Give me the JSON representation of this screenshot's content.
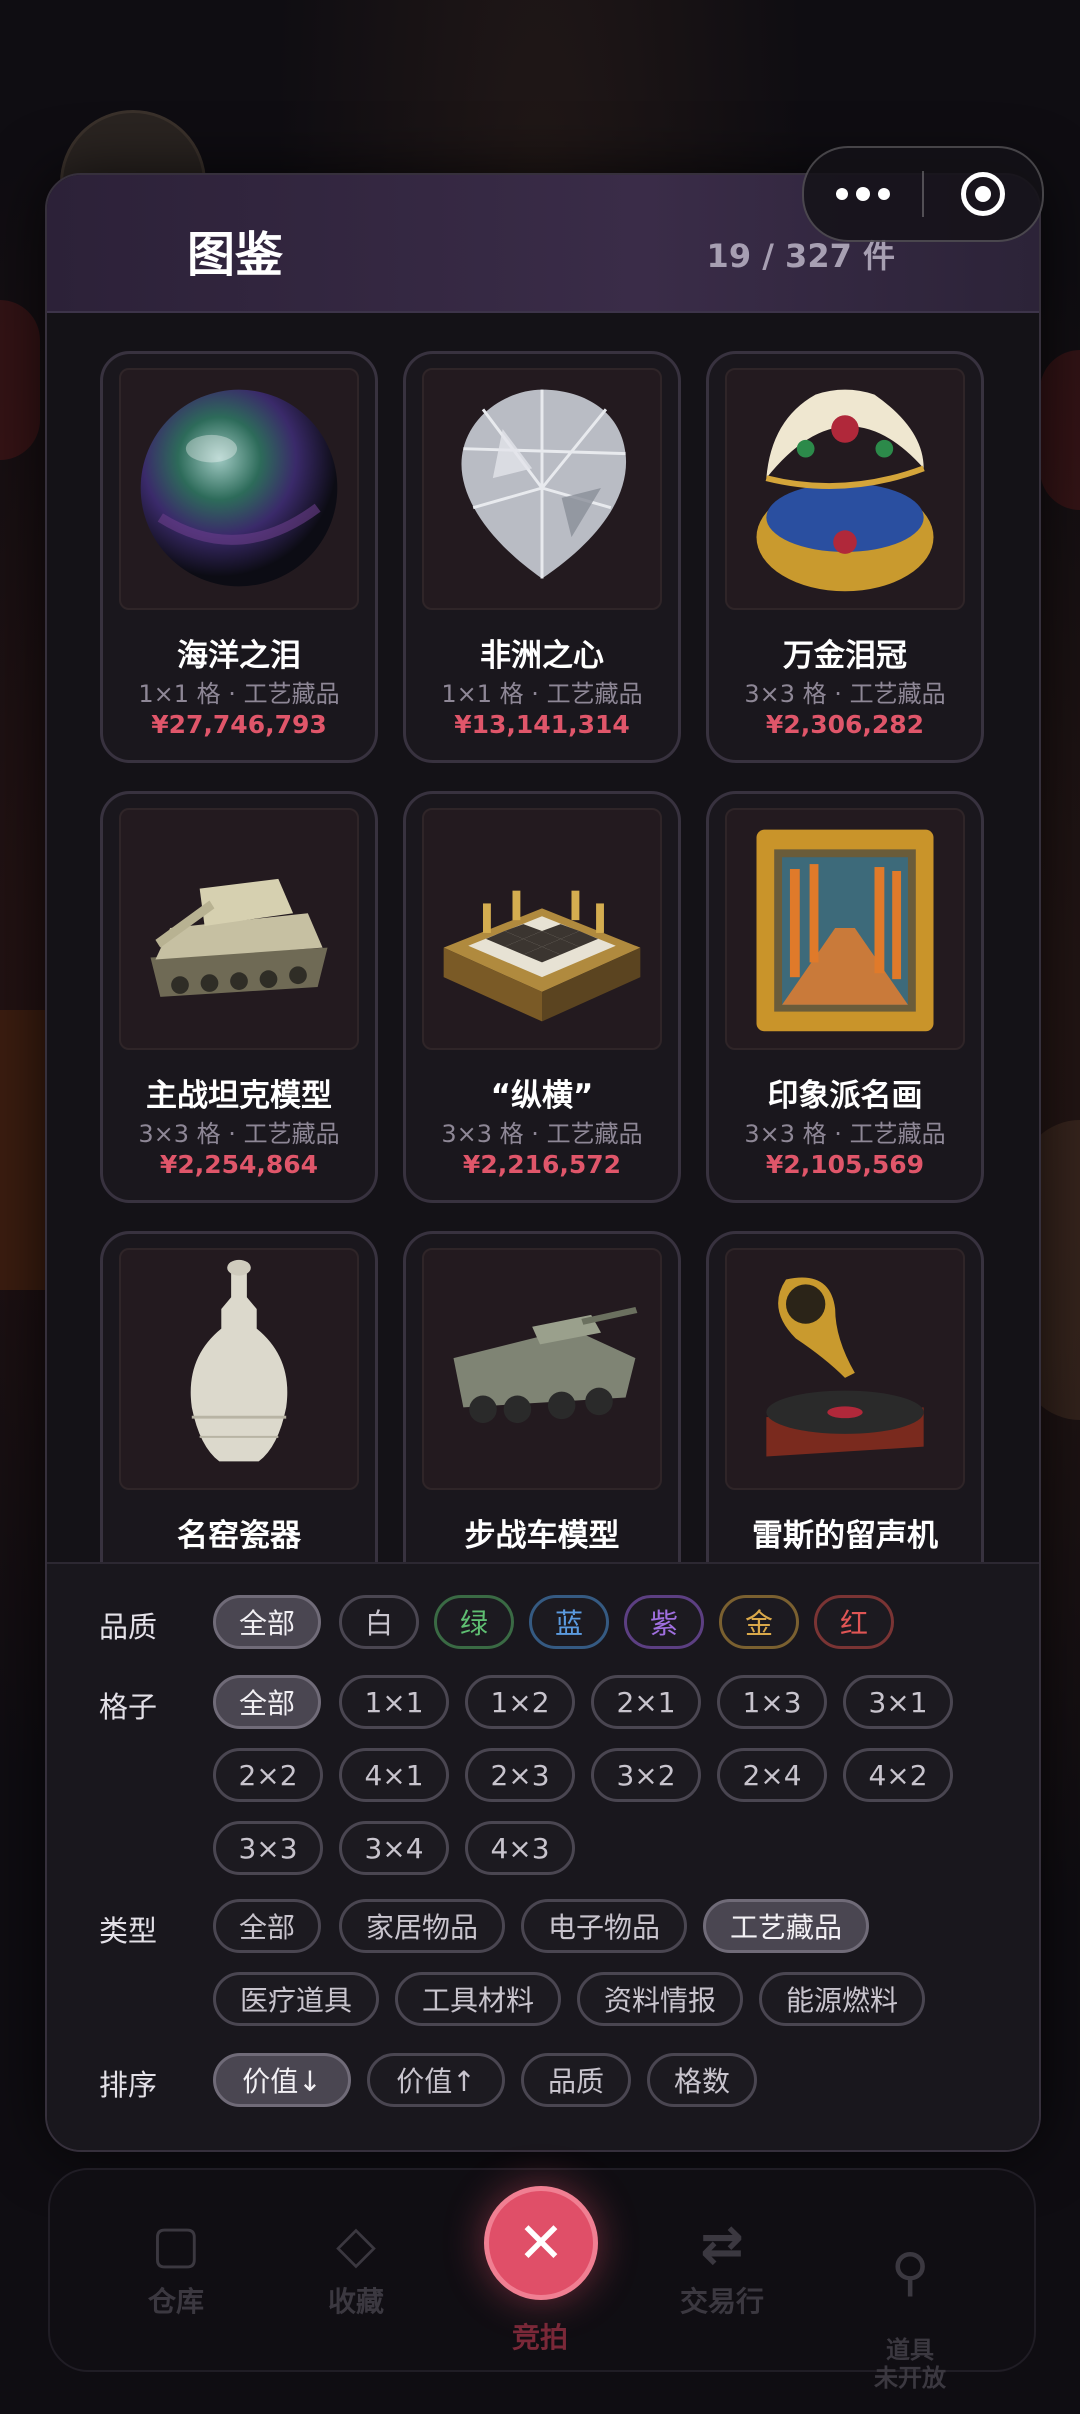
{
  "header": {
    "title": "图鉴",
    "count": "19 / 327 件"
  },
  "items": [
    {
      "name": "海洋之泪",
      "meta": "1×1 格 · 工艺藏品",
      "price": "¥27,746,793",
      "icon": "pearl-icon"
    },
    {
      "name": "非洲之心",
      "meta": "1×1 格 · 工艺藏品",
      "price": "¥13,141,314",
      "icon": "diamond-icon"
    },
    {
      "name": "万金泪冠",
      "meta": "3×3 格 · 工艺藏品",
      "price": "¥2,306,282",
      "icon": "jeweled-egg-icon"
    },
    {
      "name": "主战坦克模型",
      "meta": "3×3 格 · 工艺藏品",
      "price": "¥2,254,864",
      "icon": "tank-icon"
    },
    {
      "name": "“纵横”",
      "meta": "3×3 格 · 工艺藏品",
      "price": "¥2,216,572",
      "icon": "chessboard-icon"
    },
    {
      "name": "印象派名画",
      "meta": "3×3 格 · 工艺藏品",
      "price": "¥2,105,569",
      "icon": "painting-icon"
    },
    {
      "name": "名窑瓷器",
      "meta": "",
      "price": "",
      "icon": "porcelain-vase-icon"
    },
    {
      "name": "步战车模型",
      "meta": "",
      "price": "",
      "icon": "armored-vehicle-icon"
    },
    {
      "name": "雷斯的留声机",
      "meta": "",
      "price": "",
      "icon": "gramophone-icon"
    }
  ],
  "filters": {
    "quality": {
      "label": "品质",
      "options": [
        {
          "text": "全部",
          "color": "#c8c4cd",
          "active": true
        },
        {
          "text": "白",
          "color": "#d8d6dc"
        },
        {
          "text": "绿",
          "color": "#5fbf72"
        },
        {
          "text": "蓝",
          "color": "#5b9be0"
        },
        {
          "text": "紫",
          "color": "#a06fe0"
        },
        {
          "text": "金",
          "color": "#d9a84a"
        },
        {
          "text": "红",
          "color": "#e05555"
        }
      ]
    },
    "grid": {
      "label": "格子",
      "options": [
        "全部",
        "1×1",
        "1×2",
        "2×1",
        "1×3",
        "3×1",
        "2×2",
        "4×1",
        "2×3",
        "3×2",
        "2×4",
        "4×2",
        "3×3",
        "3×4",
        "4×3"
      ]
    },
    "type": {
      "label": "类型",
      "options": [
        "全部",
        "家居物品",
        "电子物品",
        "工艺藏品",
        "医疗道具",
        "工具材料",
        "资料情报",
        "能源燃料"
      ]
    },
    "sort": {
      "label": "排序",
      "options": [
        "价值↓",
        "价值↑",
        "品质",
        "格数"
      ]
    }
  },
  "tabbar": {
    "items": [
      "仓库",
      "收藏",
      "竞拍",
      "交易行",
      "道具\n未开放"
    ]
  }
}
